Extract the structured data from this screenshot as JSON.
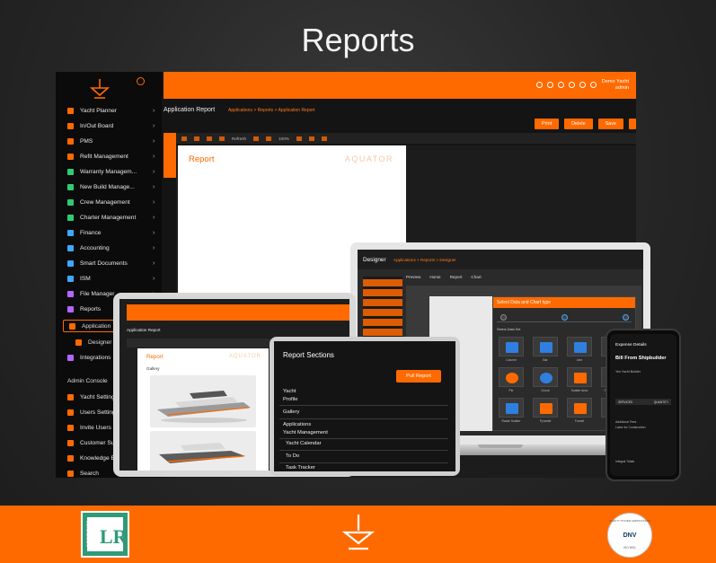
{
  "header": {
    "title": "Reports"
  },
  "app": {
    "sidebar": {
      "items": [
        {
          "label": "Yacht Planner",
          "icon": "pencil-icon",
          "color": "#ff6a00"
        },
        {
          "label": "In/Out Board",
          "icon": "board-icon",
          "color": "#ff6a00"
        },
        {
          "label": "PMS",
          "icon": "grid-icon",
          "color": "#ff6a00"
        },
        {
          "label": "Refit Management",
          "icon": "truck-icon",
          "color": "#ff6a00"
        },
        {
          "label": "Warranty Managem...",
          "icon": "shield-icon",
          "color": "#2ecc71"
        },
        {
          "label": "New Build Manage...",
          "icon": "cube-icon",
          "color": "#2ecc71"
        },
        {
          "label": "Crew Management",
          "icon": "crew-icon",
          "color": "#2ecc71"
        },
        {
          "label": "Charter Management",
          "icon": "globe-icon",
          "color": "#2ecc71"
        },
        {
          "label": "Finance",
          "icon": "dollar-icon",
          "color": "#3da8ff"
        },
        {
          "label": "Accounting",
          "icon": "chart-icon",
          "color": "#3da8ff"
        },
        {
          "label": "Smart Documents",
          "icon": "doc-icon",
          "color": "#3da8ff"
        },
        {
          "label": "ISM",
          "icon": "ism-icon",
          "color": "#3da8ff"
        },
        {
          "label": "File Manager",
          "icon": "folder-icon",
          "color": "#b565ff"
        },
        {
          "label": "Reports",
          "icon": "report-icon",
          "color": "#b565ff"
        }
      ],
      "sub_items": [
        "Application",
        "Designer"
      ],
      "integrations": "Integrations",
      "admin_console": "Admin Console",
      "admin_items": [
        {
          "label": "Yacht Setting",
          "icon": "gear-icon",
          "color": "#ff6a00"
        },
        {
          "label": "Users Setting",
          "icon": "users-icon",
          "color": "#ff6a00"
        },
        {
          "label": "Invite Users",
          "icon": "invite-icon",
          "color": "#ff6a00"
        },
        {
          "label": "Customer Su",
          "icon": "support-icon",
          "color": "#ff6a00"
        },
        {
          "label": "Knowledge B",
          "icon": "book-icon",
          "color": "#ff6a00"
        },
        {
          "label": "Search",
          "icon": "search-icon",
          "color": "#ff6a00"
        }
      ]
    },
    "topbar": {
      "user_name": "Demo Yacht",
      "user_role": "admin"
    },
    "breadcrumb": {
      "title": "Application Report",
      "path": "Applications > Reports > Application Report"
    },
    "actions": [
      "Print",
      "Delete",
      "Save"
    ],
    "toolbar": {
      "refresh": "Refresh",
      "zoom": "100%"
    },
    "report": {
      "title": "Report",
      "brand": "AQUATOR"
    }
  },
  "laptop": {
    "title": "Designer",
    "crumb": "Applications > Reports > Designer",
    "tabs": [
      "Preview",
      "Home",
      "Report",
      "Chart"
    ],
    "modal_title": "Select Data and Chart type",
    "modal_label": "Select Data Set",
    "chart_types": [
      "Column",
      "Bar",
      "Line",
      "Spiral",
      "Pie",
      "Donut",
      "Scatter Area",
      "Radar Bubble",
      "Radar Scatter",
      "Pyramid",
      "Funnel",
      "Heatmap"
    ]
  },
  "tablet": {
    "crumb": "Application Report",
    "report_title": "Report",
    "report_brand": "AQUATOR",
    "gallery": "Gallery"
  },
  "sections_panel": {
    "title": "Report Sections",
    "button": "Pull Report",
    "items": [
      "Yacht",
      "Profile",
      "Gallery",
      "Applications",
      "Yacht Management",
      "Yacht Calendar",
      "To Do",
      "Task Tracker"
    ]
  },
  "phone": {
    "heading": "Expense Details",
    "bill_from": "Bill From Shipbuilder",
    "sub": "Yes Yacht Builder",
    "table_cols": [
      "SERVICES",
      "QUANTITY"
    ],
    "lines": [
      "Additional Fees",
      "Labor for Construction",
      "Integral Totals"
    ]
  },
  "footer": {
    "lr_mark": "LR",
    "lr_certified": "CERTIFIED",
    "dnv_mark": "DNV",
    "dnv_arc": "QUALITY SYSTEM CERTIFICATION",
    "dnv_iso": "ISO 9001"
  }
}
